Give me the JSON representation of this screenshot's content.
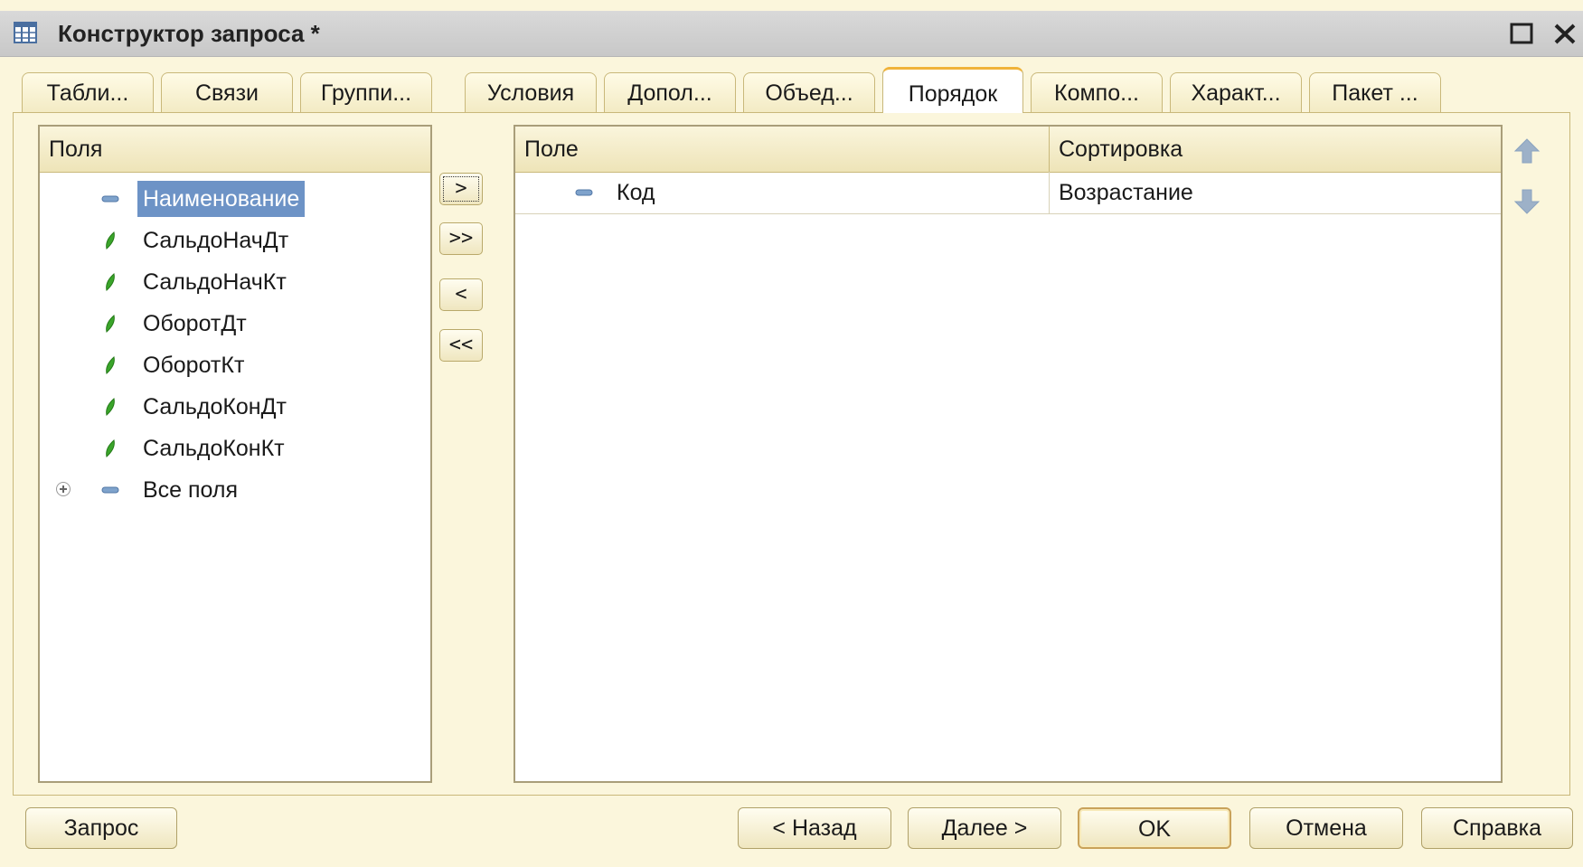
{
  "window": {
    "title": "Конструктор запроса *"
  },
  "tabs": [
    {
      "label": "Табли..."
    },
    {
      "label": "Связи"
    },
    {
      "label": "Группи..."
    },
    {
      "label": "Условия"
    },
    {
      "label": "Допол..."
    },
    {
      "label": "Объед..."
    },
    {
      "label": "Порядок",
      "active": true
    },
    {
      "label": "Компо..."
    },
    {
      "label": "Характ..."
    },
    {
      "label": "Пакет ..."
    }
  ],
  "fields_panel": {
    "header": "Поля",
    "items": [
      {
        "label": "Наименование",
        "icon": "attribute-icon",
        "selected": true
      },
      {
        "label": "СальдоНачДт",
        "icon": "resource-icon"
      },
      {
        "label": "СальдоНачКт",
        "icon": "resource-icon"
      },
      {
        "label": "ОборотДт",
        "icon": "resource-icon"
      },
      {
        "label": "ОборотКт",
        "icon": "resource-icon"
      },
      {
        "label": "СальдоКонДт",
        "icon": "resource-icon"
      },
      {
        "label": "СальдоКонКт",
        "icon": "resource-icon"
      },
      {
        "label": "Все поля",
        "icon": "attribute-icon",
        "expandable": true
      }
    ]
  },
  "move_buttons": {
    "add": ">",
    "add_all": ">>",
    "remove": "<",
    "remove_all": "<<"
  },
  "order_grid": {
    "columns": {
      "field": "Поле",
      "sort": "Сортировка"
    },
    "rows": [
      {
        "field": "Код",
        "sort": "Возрастание"
      }
    ]
  },
  "buttons": {
    "query": "Запрос",
    "back": "< Назад",
    "next": "Далее >",
    "ok": "OK",
    "cancel": "Отмена",
    "help": "Справка"
  },
  "colors": {
    "background": "#fbf6dc",
    "selection": "#6d93c6",
    "active_tab_accent": "#f0b33a",
    "resource_icon": "#3aa52a",
    "arrow_icon": "#8aa3bf"
  }
}
